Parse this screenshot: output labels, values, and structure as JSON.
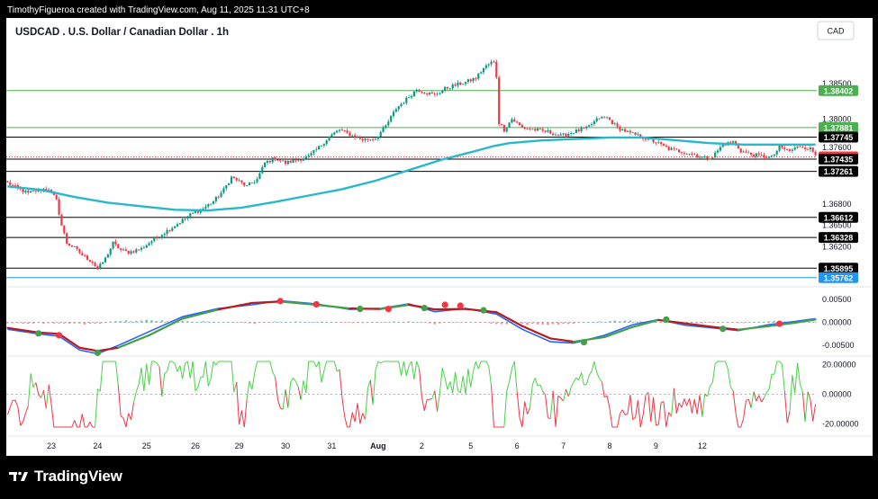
{
  "header": {
    "credit": "TimothyFigueroa created with TradingView.com, Aug 11, 2025 11:31 UTC+8"
  },
  "chart_title": "USDCAD . U.S. Dollar / Canadian Dollar . 1h",
  "currency_button": "CAD",
  "footer": {
    "brand": "TradingView"
  },
  "colors": {
    "up": "#089981",
    "down": "#f23645",
    "ma": "#27b8c9",
    "green_line": "#4caf50",
    "blue_line": "#2196f3",
    "kst_fast": "#2962ff",
    "kst_slow_up": "#43a047",
    "kst_slow_down": "#b71c1c",
    "rsi_up": "#4cd04c",
    "rsi_down": "#f23645"
  },
  "chart_data": [
    {
      "type": "candlestick",
      "symbol": "USDCAD",
      "interval": "1h",
      "x_ticks": [
        "23",
        "24",
        "25",
        "26",
        "29",
        "30",
        "31",
        "Aug",
        "2",
        "5",
        "6",
        "7",
        "8",
        "9",
        "12"
      ],
      "y_ticks": [
        "1.38500",
        "1.38000",
        "1.37600",
        "1.36800",
        "1.36500",
        "1.36200"
      ],
      "ylim": [
        1.3567,
        1.3892
      ],
      "close_path": [
        [
          0,
          1.371
        ],
        [
          4,
          1.3702
        ],
        [
          8,
          1.3695
        ],
        [
          12,
          1.37
        ],
        [
          16,
          1.3702
        ],
        [
          19,
          1.3685
        ],
        [
          21,
          1.365
        ],
        [
          23,
          1.3625
        ],
        [
          26,
          1.3618
        ],
        [
          29,
          1.3608
        ],
        [
          33,
          1.3598
        ],
        [
          35,
          1.3588
        ],
        [
          38,
          1.3603
        ],
        [
          41,
          1.3625
        ],
        [
          44,
          1.3615
        ],
        [
          47,
          1.3612
        ],
        [
          52,
          1.3617
        ],
        [
          56,
          1.3628
        ],
        [
          61,
          1.364
        ],
        [
          66,
          1.3652
        ],
        [
          71,
          1.3665
        ],
        [
          76,
          1.3674
        ],
        [
          80,
          1.3684
        ],
        [
          84,
          1.37
        ],
        [
          87,
          1.3718
        ],
        [
          90,
          1.3712
        ],
        [
          93,
          1.3705
        ],
        [
          97,
          1.3715
        ],
        [
          100,
          1.3738
        ],
        [
          104,
          1.3745
        ],
        [
          108,
          1.3738
        ],
        [
          112,
          1.3742
        ],
        [
          117,
          1.3747
        ],
        [
          121,
          1.376
        ],
        [
          125,
          1.3775
        ],
        [
          129,
          1.3785
        ],
        [
          133,
          1.3778
        ],
        [
          138,
          1.3771
        ],
        [
          143,
          1.3773
        ],
        [
          147,
          1.379
        ],
        [
          151,
          1.3815
        ],
        [
          155,
          1.3828
        ],
        [
          159,
          1.3842
        ],
        [
          162,
          1.3838
        ],
        [
          166,
          1.3834
        ],
        [
          170,
          1.3843
        ],
        [
          174,
          1.3848
        ],
        [
          178,
          1.3852
        ],
        [
          182,
          1.3858
        ],
        [
          185,
          1.3872
        ],
        [
          188,
          1.388
        ],
        [
          189,
          1.388
        ],
        [
          190,
          1.386
        ],
        [
          191,
          1.3795
        ],
        [
          193,
          1.3785
        ],
        [
          196,
          1.38
        ],
        [
          200,
          1.3788
        ],
        [
          205,
          1.3785
        ],
        [
          210,
          1.3782
        ],
        [
          215,
          1.3776
        ],
        [
          220,
          1.3782
        ],
        [
          225,
          1.3787
        ],
        [
          230,
          1.3802
        ],
        [
          233,
          1.3802
        ],
        [
          237,
          1.3788
        ],
        [
          242,
          1.378
        ],
        [
          247,
          1.3774
        ],
        [
          252,
          1.3767
        ],
        [
          257,
          1.3758
        ],
        [
          262,
          1.3754
        ],
        [
          267,
          1.375
        ],
        [
          271,
          1.3745
        ],
        [
          274,
          1.3747
        ],
        [
          278,
          1.3764
        ],
        [
          282,
          1.3768
        ],
        [
          285,
          1.3755
        ],
        [
          289,
          1.375
        ],
        [
          293,
          1.3748
        ],
        [
          297,
          1.3746
        ],
        [
          300,
          1.376
        ],
        [
          304,
          1.3755
        ],
        [
          308,
          1.3762
        ],
        [
          312,
          1.3758
        ],
        [
          314,
          1.375
        ]
      ],
      "ma_path": [
        [
          0,
          1.3705
        ],
        [
          13,
          1.37
        ],
        [
          26,
          1.369
        ],
        [
          39,
          1.3682
        ],
        [
          52,
          1.3677
        ],
        [
          65,
          1.3672
        ],
        [
          78,
          1.3671
        ],
        [
          91,
          1.3675
        ],
        [
          104,
          1.3683
        ],
        [
          117,
          1.3692
        ],
        [
          130,
          1.3701
        ],
        [
          143,
          1.3713
        ],
        [
          156,
          1.3728
        ],
        [
          169,
          1.3743
        ],
        [
          182,
          1.3755
        ],
        [
          189,
          1.3762
        ],
        [
          195,
          1.3766
        ],
        [
          208,
          1.377
        ],
        [
          221,
          1.3772
        ],
        [
          234,
          1.3774
        ],
        [
          247,
          1.3774
        ],
        [
          260,
          1.377
        ],
        [
          273,
          1.3766
        ],
        [
          286,
          1.3764
        ],
        [
          299,
          1.3764
        ],
        [
          314,
          1.3764
        ]
      ],
      "horizontal_levels": [
        {
          "value": 1.38402,
          "label": "1.38402",
          "color": "#4caf50"
        },
        {
          "value": 1.37881,
          "label": "1.37881",
          "color": "#4caf50"
        },
        {
          "value": 1.37745,
          "label": "1.37745",
          "color": "#000000"
        },
        {
          "value": 1.37467,
          "label": "1.37467",
          "color": "#f23645",
          "dotted": true
        },
        {
          "value": 1.37435,
          "label": "1.37435",
          "color": "#000000"
        },
        {
          "value": 1.37261,
          "label": "1.37261",
          "color": "#000000"
        },
        {
          "value": 1.36612,
          "label": "1.36612",
          "color": "#000000"
        },
        {
          "value": 1.36328,
          "label": "1.36328",
          "color": "#000000"
        },
        {
          "value": 1.35895,
          "label": "1.35895",
          "color": "#000000"
        },
        {
          "value": 1.35762,
          "label": "1.35762",
          "color": "#2196f3"
        }
      ]
    },
    {
      "type": "line",
      "panel": "oscillator",
      "y_ticks": [
        "0.00500",
        "0.00000",
        "-0.00500"
      ],
      "ylim": [
        -0.0075,
        0.0075
      ],
      "fast_path": [
        [
          0,
          -0.0015
        ],
        [
          12,
          -0.0025
        ],
        [
          20,
          -0.003
        ],
        [
          28,
          -0.006
        ],
        [
          35,
          -0.0068
        ],
        [
          43,
          -0.005
        ],
        [
          55,
          -0.002
        ],
        [
          68,
          0.0012
        ],
        [
          82,
          0.003
        ],
        [
          95,
          0.0038
        ],
        [
          106,
          0.0047
        ],
        [
          120,
          0.004
        ],
        [
          133,
          0.0028
        ],
        [
          145,
          0.003
        ],
        [
          156,
          0.004
        ],
        [
          166,
          0.0023
        ],
        [
          178,
          0.003
        ],
        [
          190,
          0.0018
        ],
        [
          200,
          -0.0015
        ],
        [
          211,
          -0.0042
        ],
        [
          220,
          -0.0045
        ],
        [
          232,
          -0.0028
        ],
        [
          243,
          -0.0005
        ],
        [
          253,
          0.0006
        ],
        [
          263,
          -0.0006
        ],
        [
          274,
          -0.0012
        ],
        [
          284,
          -0.0018
        ],
        [
          296,
          -0.0005
        ],
        [
          306,
          0.0002
        ],
        [
          314,
          0.0008
        ]
      ],
      "slow_path": [
        [
          0,
          -0.0012
        ],
        [
          12,
          -0.0022
        ],
        [
          20,
          -0.0025
        ],
        [
          28,
          -0.0055
        ],
        [
          35,
          -0.0062
        ],
        [
          43,
          -0.0055
        ],
        [
          55,
          -0.0028
        ],
        [
          68,
          0.0008
        ],
        [
          82,
          0.0028
        ],
        [
          95,
          0.0042
        ],
        [
          106,
          0.0045
        ],
        [
          120,
          0.0038
        ],
        [
          133,
          0.003
        ],
        [
          145,
          0.0029
        ],
        [
          156,
          0.0038
        ],
        [
          166,
          0.0028
        ],
        [
          178,
          0.0029
        ],
        [
          190,
          0.0022
        ],
        [
          200,
          -0.0008
        ],
        [
          211,
          -0.0035
        ],
        [
          220,
          -0.0042
        ],
        [
          232,
          -0.0032
        ],
        [
          243,
          -0.001
        ],
        [
          253,
          0.0005
        ],
        [
          263,
          -0.0002
        ],
        [
          274,
          -0.001
        ],
        [
          284,
          -0.0016
        ],
        [
          296,
          -0.0008
        ],
        [
          306,
          -0.0001
        ],
        [
          314,
          0.0006
        ]
      ],
      "cross_points": [
        [
          12,
          -0.0024,
          "up"
        ],
        [
          20,
          -0.0028,
          "down"
        ],
        [
          35,
          -0.0066,
          "up"
        ],
        [
          106,
          0.0046,
          "down"
        ],
        [
          120,
          0.0039,
          "down"
        ],
        [
          137,
          0.0029,
          "up"
        ],
        [
          148,
          0.0029,
          "down"
        ],
        [
          162,
          0.0031,
          "up"
        ],
        [
          170,
          0.0038,
          "down"
        ],
        [
          176,
          0.0036,
          "down"
        ],
        [
          185,
          0.0026,
          "up"
        ],
        [
          224,
          -0.0043,
          "up"
        ],
        [
          256,
          0.0006,
          "up"
        ],
        [
          278,
          -0.0014,
          "up"
        ],
        [
          300,
          -0.0003,
          "down"
        ]
      ]
    },
    {
      "type": "line",
      "panel": "rsi-oscillator",
      "y_ticks": [
        "20.00000",
        "0.00000",
        "-20.00000"
      ],
      "ylim": [
        -25,
        25
      ]
    }
  ]
}
